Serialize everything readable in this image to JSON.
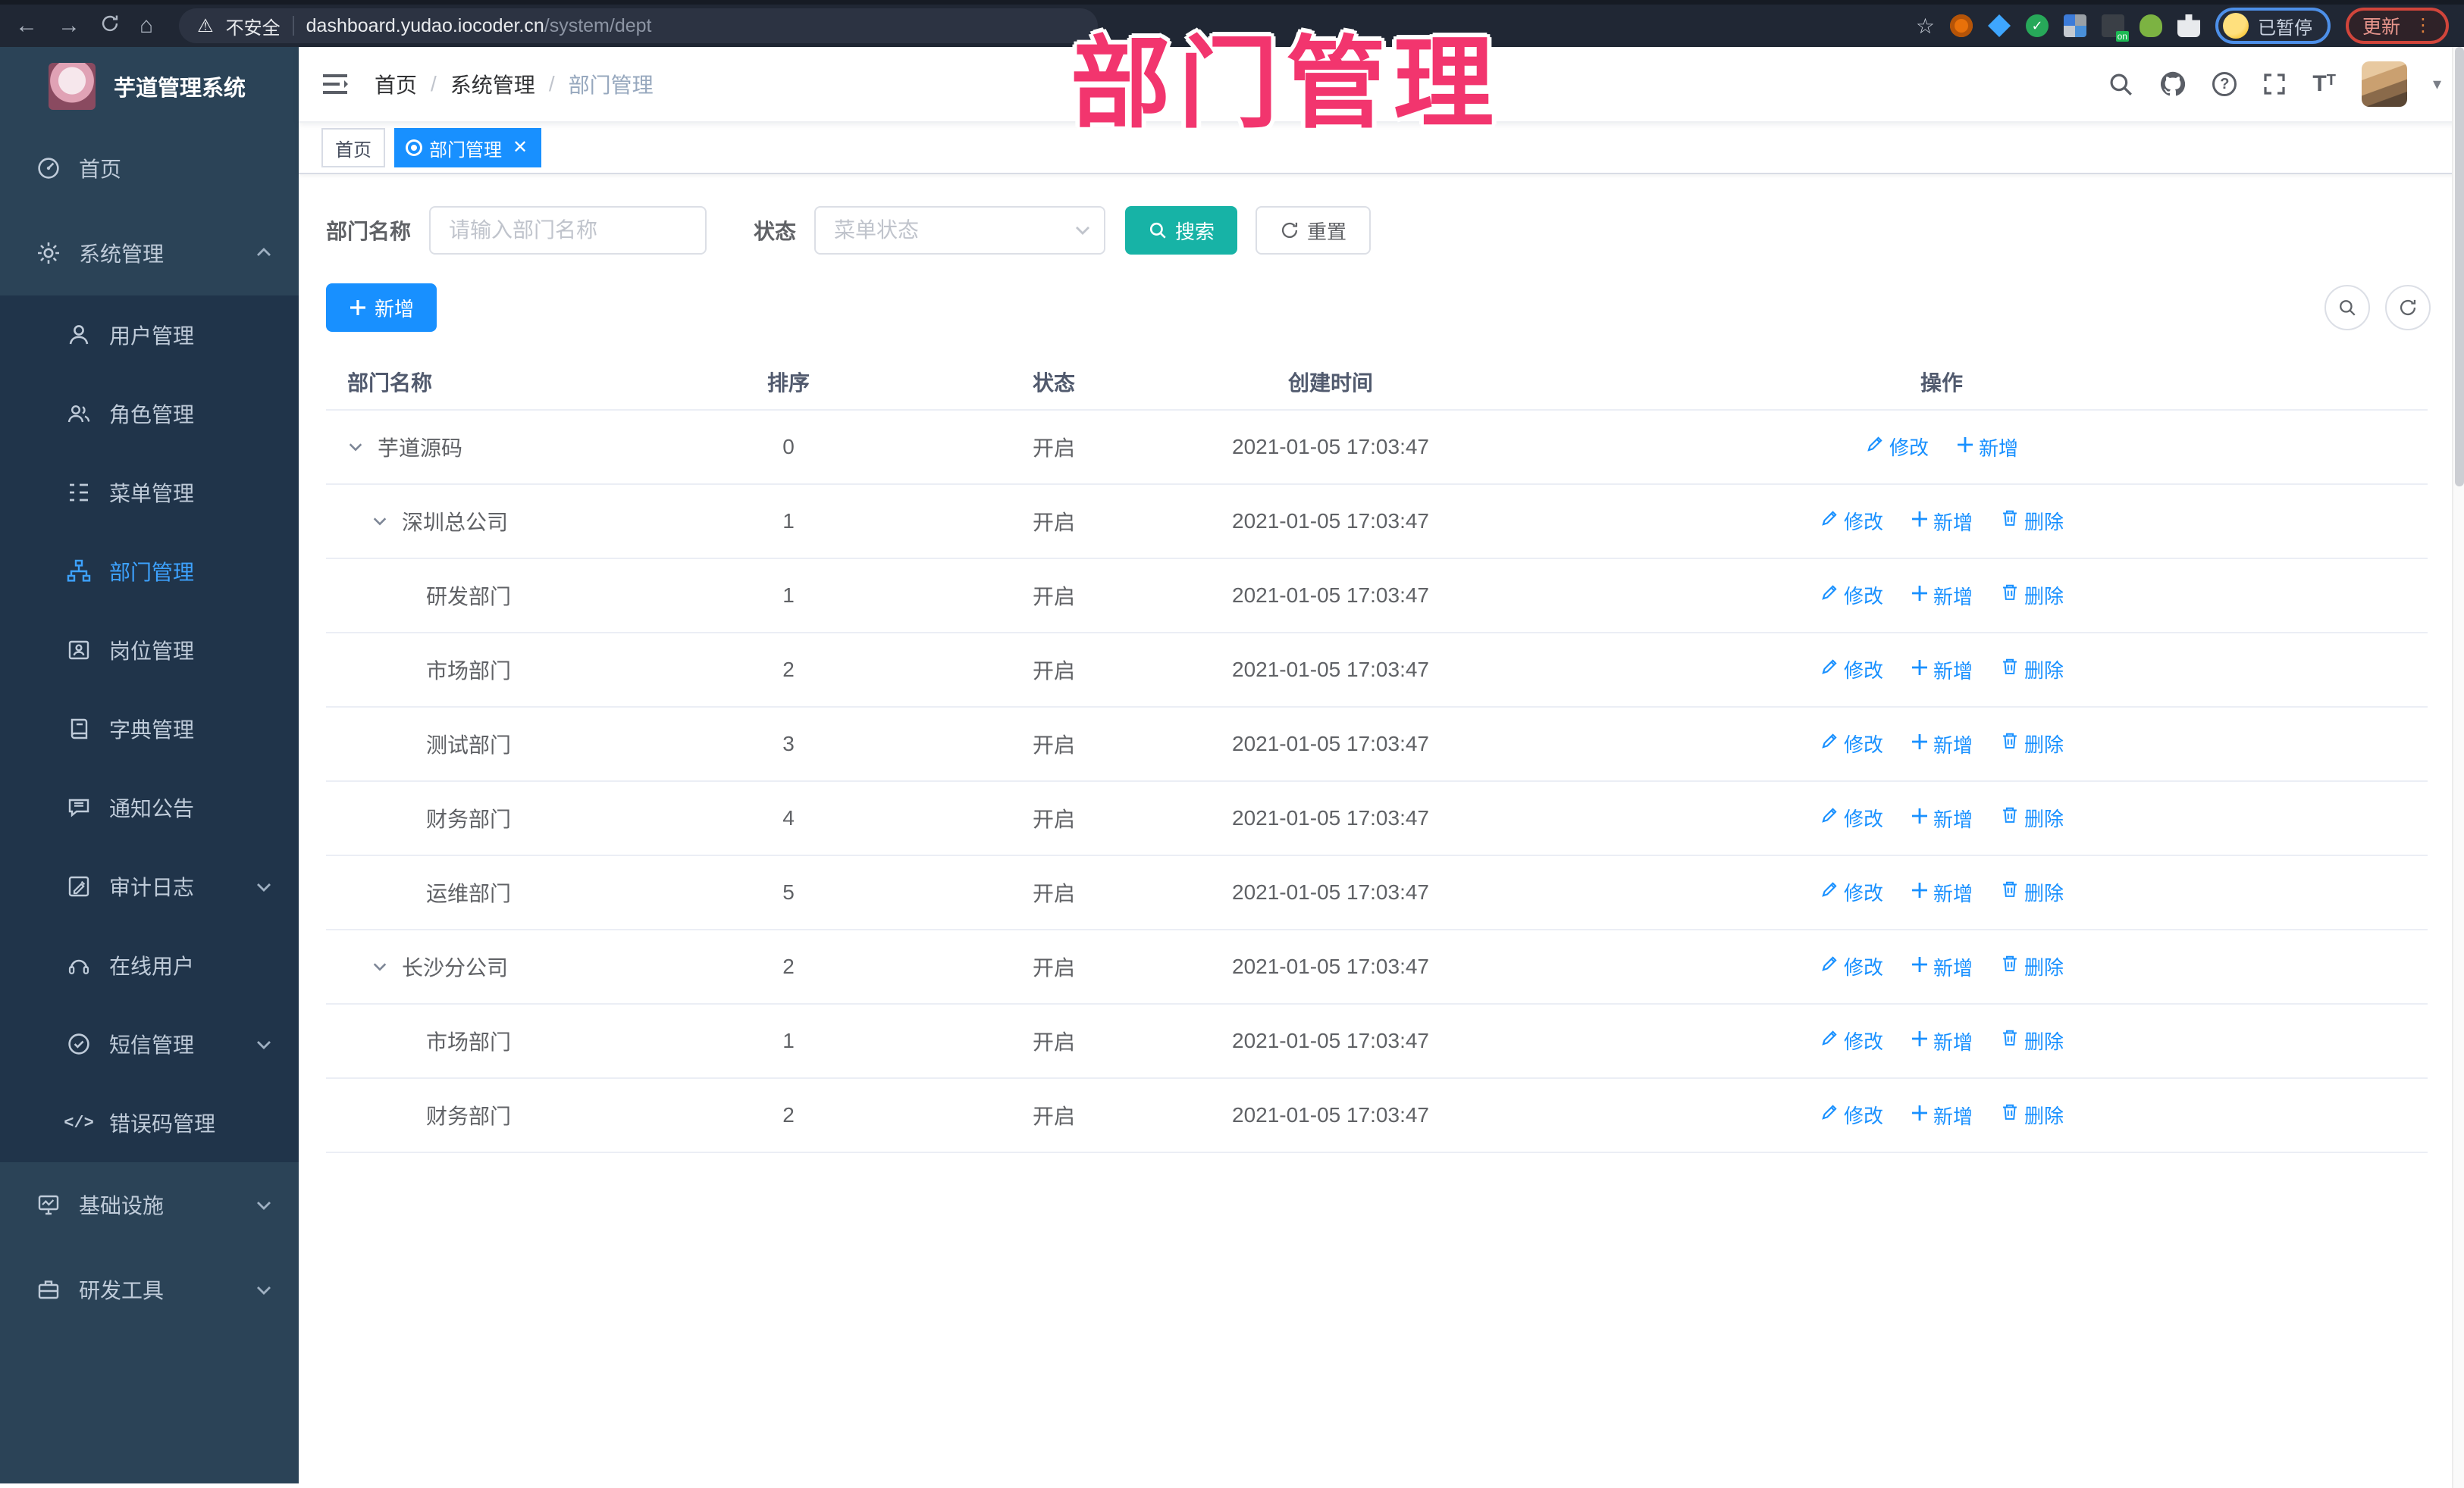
{
  "overlay_title": "部门管理",
  "browser": {
    "security_label": "不安全",
    "url_host": "dashboard.yudao.iocoder.cn",
    "url_path": "/system/dept",
    "paused_label": "已暂停",
    "update_label": "更新"
  },
  "sidebar": {
    "app_title": "芋道管理系统",
    "menu": [
      {
        "label": "首页",
        "icon": "dashboard-icon"
      },
      {
        "label": "系统管理",
        "icon": "gear-icon",
        "expanded": true,
        "children": [
          {
            "label": "用户管理",
            "icon": "user-icon"
          },
          {
            "label": "角色管理",
            "icon": "users-icon"
          },
          {
            "label": "菜单管理",
            "icon": "menu-tree-icon"
          },
          {
            "label": "部门管理",
            "icon": "org-icon",
            "active": true
          },
          {
            "label": "岗位管理",
            "icon": "badge-icon"
          },
          {
            "label": "字典管理",
            "icon": "dict-icon"
          },
          {
            "label": "通知公告",
            "icon": "announcement-icon"
          },
          {
            "label": "审计日志",
            "icon": "audit-icon",
            "collapsible": true
          },
          {
            "label": "在线用户",
            "icon": "online-icon"
          },
          {
            "label": "短信管理",
            "icon": "sms-icon",
            "collapsible": true
          },
          {
            "label": "错误码管理",
            "icon": "code-icon"
          }
        ]
      },
      {
        "label": "基础设施",
        "icon": "infra-icon",
        "collapsible": true
      },
      {
        "label": "研发工具",
        "icon": "tools-icon",
        "collapsible": true
      }
    ]
  },
  "navbar": {
    "breadcrumb": [
      "首页",
      "系统管理",
      "部门管理"
    ]
  },
  "tabs": [
    {
      "label": "首页",
      "active": false
    },
    {
      "label": "部门管理",
      "active": true,
      "closable": true
    }
  ],
  "filters": {
    "dept_name_label": "部门名称",
    "dept_name_placeholder": "请输入部门名称",
    "status_label": "状态",
    "status_placeholder": "菜单状态",
    "search_label": "搜索",
    "reset_label": "重置"
  },
  "toolbar": {
    "add_label": "新增"
  },
  "table": {
    "columns": [
      "部门名称",
      "排序",
      "状态",
      "创建时间",
      "操作"
    ],
    "rows": [
      {
        "name": "芋道源码",
        "level": 0,
        "expandable": true,
        "sort": "0",
        "status": "开启",
        "created": "2021-01-05 17:03:47",
        "actions": [
          {
            "label": "修改",
            "icon": "edit-icon",
            "name": "edit"
          },
          {
            "label": "新增",
            "icon": "plus-icon",
            "name": "add"
          }
        ]
      },
      {
        "name": "深圳总公司",
        "level": 1,
        "expandable": true,
        "sort": "1",
        "status": "开启",
        "created": "2021-01-05 17:03:47",
        "actions": [
          {
            "label": "修改",
            "icon": "edit-icon",
            "name": "edit"
          },
          {
            "label": "新增",
            "icon": "plus-icon",
            "name": "add"
          },
          {
            "label": "删除",
            "icon": "trash-icon",
            "name": "delete"
          }
        ]
      },
      {
        "name": "研发部门",
        "level": 2,
        "expandable": false,
        "sort": "1",
        "status": "开启",
        "created": "2021-01-05 17:03:47",
        "actions": [
          {
            "label": "修改",
            "icon": "edit-icon",
            "name": "edit"
          },
          {
            "label": "新增",
            "icon": "plus-icon",
            "name": "add"
          },
          {
            "label": "删除",
            "icon": "trash-icon",
            "name": "delete"
          }
        ]
      },
      {
        "name": "市场部门",
        "level": 2,
        "expandable": false,
        "sort": "2",
        "status": "开启",
        "created": "2021-01-05 17:03:47",
        "actions": [
          {
            "label": "修改",
            "icon": "edit-icon",
            "name": "edit"
          },
          {
            "label": "新增",
            "icon": "plus-icon",
            "name": "add"
          },
          {
            "label": "删除",
            "icon": "trash-icon",
            "name": "delete"
          }
        ]
      },
      {
        "name": "测试部门",
        "level": 2,
        "expandable": false,
        "sort": "3",
        "status": "开启",
        "created": "2021-01-05 17:03:47",
        "actions": [
          {
            "label": "修改",
            "icon": "edit-icon",
            "name": "edit"
          },
          {
            "label": "新增",
            "icon": "plus-icon",
            "name": "add"
          },
          {
            "label": "删除",
            "icon": "trash-icon",
            "name": "delete"
          }
        ]
      },
      {
        "name": "财务部门",
        "level": 2,
        "expandable": false,
        "sort": "4",
        "status": "开启",
        "created": "2021-01-05 17:03:47",
        "actions": [
          {
            "label": "修改",
            "icon": "edit-icon",
            "name": "edit"
          },
          {
            "label": "新增",
            "icon": "plus-icon",
            "name": "add"
          },
          {
            "label": "删除",
            "icon": "trash-icon",
            "name": "delete"
          }
        ]
      },
      {
        "name": "运维部门",
        "level": 2,
        "expandable": false,
        "sort": "5",
        "status": "开启",
        "created": "2021-01-05 17:03:47",
        "actions": [
          {
            "label": "修改",
            "icon": "edit-icon",
            "name": "edit"
          },
          {
            "label": "新增",
            "icon": "plus-icon",
            "name": "add"
          },
          {
            "label": "删除",
            "icon": "trash-icon",
            "name": "delete"
          }
        ]
      },
      {
        "name": "长沙分公司",
        "level": 1,
        "expandable": true,
        "sort": "2",
        "status": "开启",
        "created": "2021-01-05 17:03:47",
        "actions": [
          {
            "label": "修改",
            "icon": "edit-icon",
            "name": "edit"
          },
          {
            "label": "新增",
            "icon": "plus-icon",
            "name": "add"
          },
          {
            "label": "删除",
            "icon": "trash-icon",
            "name": "delete"
          }
        ]
      },
      {
        "name": "市场部门",
        "level": 2,
        "expandable": false,
        "sort": "1",
        "status": "开启",
        "created": "2021-01-05 17:03:47",
        "actions": [
          {
            "label": "修改",
            "icon": "edit-icon",
            "name": "edit"
          },
          {
            "label": "新增",
            "icon": "plus-icon",
            "name": "add"
          },
          {
            "label": "删除",
            "icon": "trash-icon",
            "name": "delete"
          }
        ]
      },
      {
        "name": "财务部门",
        "level": 2,
        "expandable": false,
        "sort": "2",
        "status": "开启",
        "created": "2021-01-05 17:03:47",
        "actions": [
          {
            "label": "修改",
            "icon": "edit-icon",
            "name": "edit"
          },
          {
            "label": "新增",
            "icon": "plus-icon",
            "name": "add"
          },
          {
            "label": "删除",
            "icon": "trash-icon",
            "name": "delete"
          }
        ]
      }
    ]
  },
  "colors": {
    "primary_blue": "#1890ff",
    "search_teal": "#17b3a6",
    "overlay_pink": "#f2356e",
    "sidebar_bg": "#2b4357",
    "submenu_bg": "#20344a",
    "active_menu_blue": "#3da2ff"
  }
}
